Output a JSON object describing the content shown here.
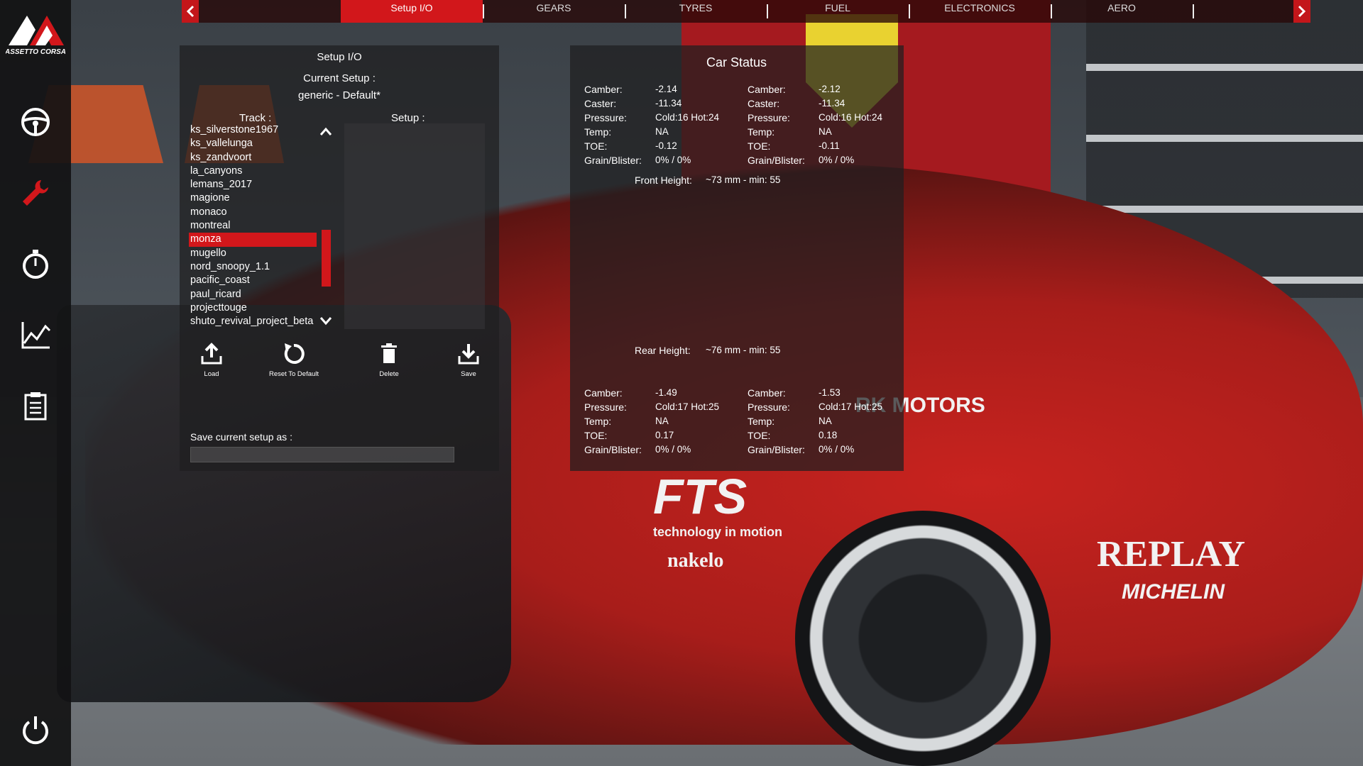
{
  "app": {
    "logo_text": "ASSETTO CORSA"
  },
  "sidebar": {
    "items": [
      {
        "icon": "steering-wheel-icon"
      },
      {
        "icon": "wrench-icon",
        "active": true
      },
      {
        "icon": "stopwatch-icon"
      },
      {
        "icon": "telemetry-chart-icon"
      },
      {
        "icon": "clipboard-icon"
      },
      {
        "icon": "power-icon"
      }
    ],
    "accent": "#d2171b"
  },
  "tabs": [
    "Setup I/O",
    "GEARS",
    "TYRES",
    "FUEL",
    "ELECTRONICS",
    "AERO"
  ],
  "active_tab": "Setup I/O",
  "setup_io": {
    "title": "Setup I/O",
    "current_setup_label": "Current Setup :",
    "current_setup_value": "generic - Default*",
    "track_label": "Track :",
    "setup_label": "Setup :",
    "tracks": [
      "ks_silverstone1967",
      "ks_vallelunga",
      "ks_zandvoort",
      "la_canyons",
      "lemans_2017",
      "magione",
      "monaco",
      "montreal",
      "monza",
      "mugello",
      "nord_snoopy_1.1",
      "pacific_coast",
      "paul_ricard",
      "projecttouge",
      "shuto_revival_project_beta"
    ],
    "selected_track": "monza",
    "actions": {
      "load": "Load",
      "reset": "Reset To Default",
      "delete": "Delete",
      "save": "Save"
    },
    "save_as_label": "Save current setup as :",
    "save_as_value": ""
  },
  "car_status": {
    "title": "Car Status",
    "labels": {
      "camber": "Camber:",
      "caster": "Caster:",
      "pressure": "Pressure:",
      "temp": "Temp:",
      "toe": "TOE:",
      "grain": "Grain/Blister:",
      "front_height": "Front Height:",
      "rear_height": "Rear Height:"
    },
    "front_left": {
      "camber": "-2.14",
      "caster": "-11.34",
      "pressure": "Cold:16 Hot:24",
      "temp": "NA",
      "toe": "-0.12",
      "grain": "0% / 0%"
    },
    "front_right": {
      "camber": "-2.12",
      "caster": "-11.34",
      "pressure": "Cold:16 Hot:24",
      "temp": "NA",
      "toe": "-0.11",
      "grain": "0% / 0%"
    },
    "front_height": "~73 mm - min: 55",
    "rear_height": "~76 mm - min: 55",
    "rear_left": {
      "camber": "-1.49",
      "pressure": "Cold:17 Hot:25",
      "temp": "NA",
      "toe": "0.17",
      "grain": "0% / 0%"
    },
    "rear_right": {
      "camber": "-1.53",
      "pressure": "Cold:17 Hot:25",
      "temp": "NA",
      "toe": "0.18",
      "grain": "0% / 0%"
    }
  },
  "livery": {
    "sponsor1": "FTS",
    "sponsor1_sub": "technology in motion",
    "sponsor2": "REPLAY",
    "sponsor3": "MICHELIN",
    "sponsor4": "RK MOTORS",
    "sponsor5": "nakelo"
  }
}
